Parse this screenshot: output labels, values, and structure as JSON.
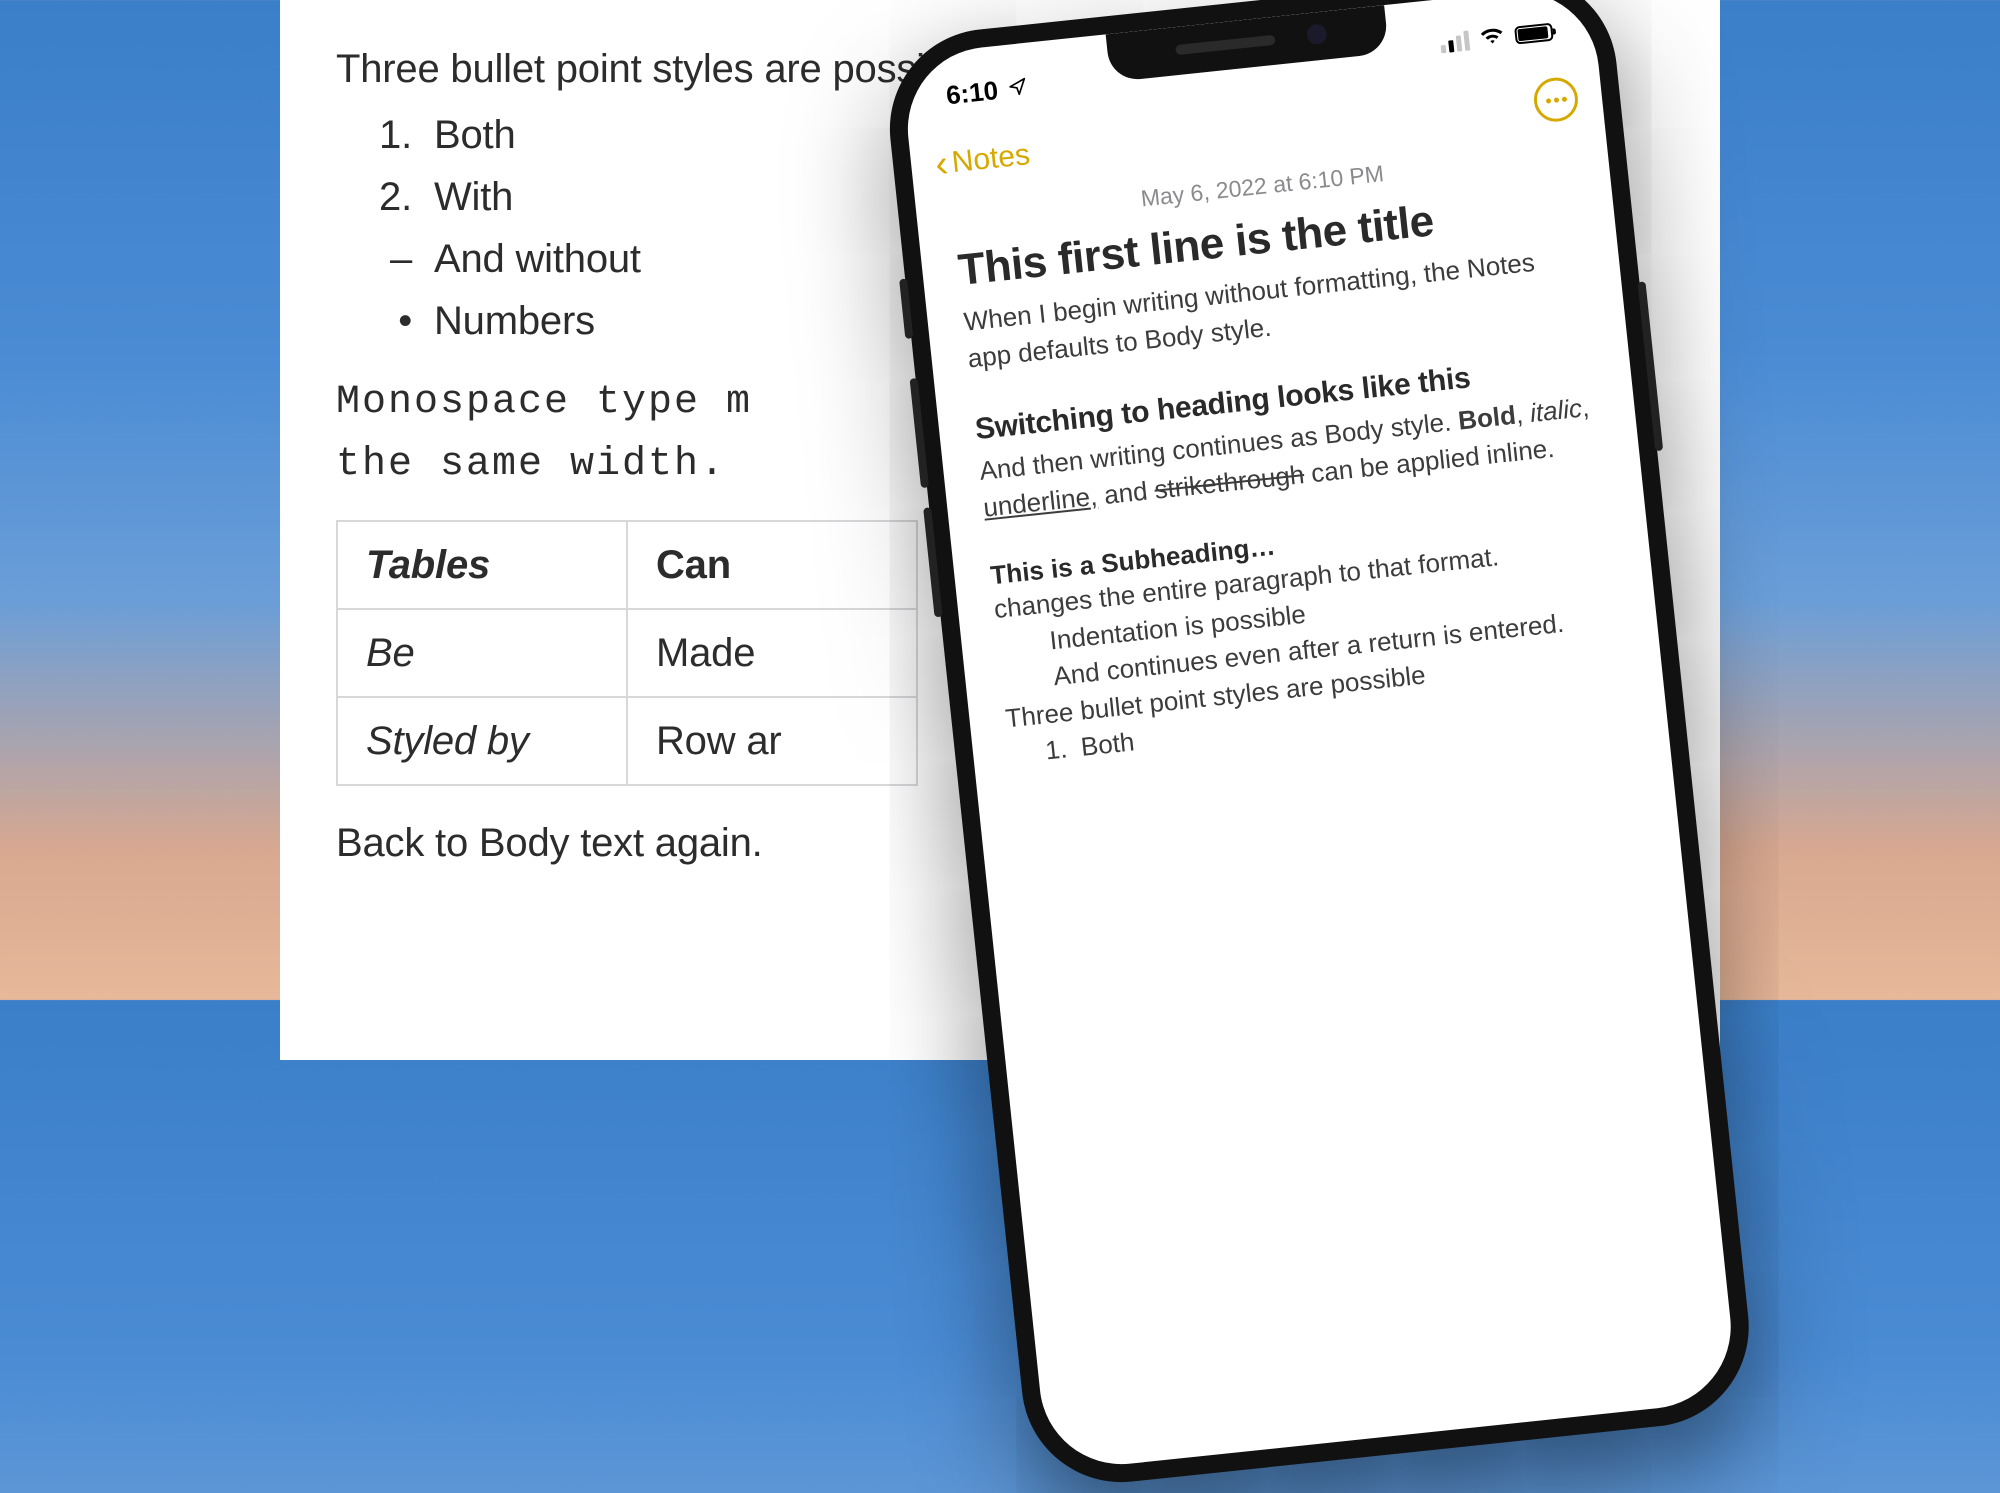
{
  "background_doc": {
    "intro": "Three bullet point styles are possible",
    "bullets": [
      {
        "marker": "1.",
        "text": "Both"
      },
      {
        "marker": "2.",
        "text": "With"
      },
      {
        "marker": "–",
        "text": "And without"
      },
      {
        "marker": "•",
        "text": "Numbers"
      }
    ],
    "mono_line1": "Monospace type m",
    "mono_line2": "the same width.",
    "table": [
      [
        "Tables",
        "Can"
      ],
      [
        "Be",
        "Made"
      ],
      [
        "Styled by",
        "Row ar"
      ]
    ],
    "back_text": "Back to Body text again."
  },
  "phone": {
    "status": {
      "time": "6:10"
    },
    "nav": {
      "back": "Notes"
    },
    "note": {
      "date": "May 6, 2022 at 6:10 PM",
      "title": "This first line is the title",
      "body1": "When I begin writing without formatting, the Notes app defaults to Body style.",
      "heading": "Switching to heading looks like this",
      "body2_pre": "And then writing continues as Body style. ",
      "bold": "Bold",
      "sep1": ", ",
      "italic": "italic",
      "sep2": ", ",
      "underline": "underline,",
      "sep3": " and ",
      "strike": "strikethrough",
      "body2_post": " can be applied inline.",
      "subheading": "This is a Subheading…",
      "body3": "changes the entire paragraph to that format.",
      "indent1": "Indentation is possible",
      "indent2": "And continues even after a return is entered.",
      "bullets_intro": "Three bullet point styles are possible",
      "ol": [
        {
          "n": "1.",
          "t": "Both"
        }
      ]
    }
  }
}
